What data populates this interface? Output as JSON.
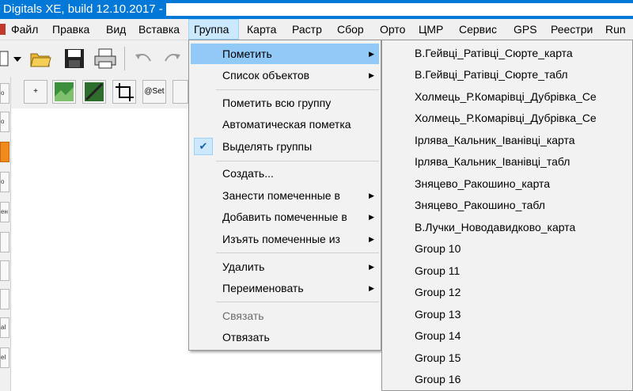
{
  "window": {
    "title": "Digitals XE, build 12.10.2017 - "
  },
  "menubar": {
    "items": [
      "Файл",
      "Правка",
      "Вид",
      "Вставка",
      "Группа",
      "Карта",
      "Растр",
      "Сбор",
      "Орто",
      "ЦМР",
      "Сервис",
      "GPS",
      "Реестри",
      "Run"
    ],
    "active": "Группа"
  },
  "toolbar2": {
    "plus": "+",
    "set": "@Set"
  },
  "left_strip": [
    "o",
    "o",
    "o",
    "ен",
    "al",
    "el"
  ],
  "group_menu": {
    "items": [
      {
        "label": "Пометить",
        "submenu": true,
        "highlighted": true
      },
      {
        "label": "Список объектов",
        "submenu": true
      },
      {
        "label": "Пометить всю группу"
      },
      {
        "label": "Автоматическая пометка"
      },
      {
        "label": "Выделять группы",
        "checked": true
      },
      {
        "label": "Создать..."
      },
      {
        "label": "Занести помеченные в",
        "submenu": true
      },
      {
        "label": "Добавить помеченные в",
        "submenu": true
      },
      {
        "label": "Изъять помеченные из",
        "submenu": true
      },
      {
        "label": "Удалить",
        "submenu": true
      },
      {
        "label": "Переименовать",
        "submenu": true
      },
      {
        "label": "Связать",
        "disabled": true
      },
      {
        "label": "Отвязать"
      }
    ],
    "check_glyph": "✔",
    "arrow_glyph": "▶"
  },
  "mark_submenu": {
    "items": [
      "В.Гейвці_Ратівці_Сюрте_карта",
      "В.Гейвці_Ратівці_Сюрте_табл",
      "Холмець_Р.Комарівці_Дубрівка_Се",
      "Холмець_Р.Комарівці_Дубрівка_Се",
      "Ірлява_Кальник_Іванівці_карта",
      "Ірлява_Кальник_Іванівці_табл",
      "Зняцево_Ракошино_карта",
      "Зняцево_Ракошино_табл",
      "В.Лучки_Новодавидково_карта",
      "Group 10",
      "Group 11",
      "Group 12",
      "Group 13",
      "Group 14",
      "Group 15",
      "Group 16"
    ]
  },
  "colors": {
    "titlebar": "#0078d7",
    "highlight": "#91c9f7",
    "menu_bg": "#f2f2f2"
  }
}
